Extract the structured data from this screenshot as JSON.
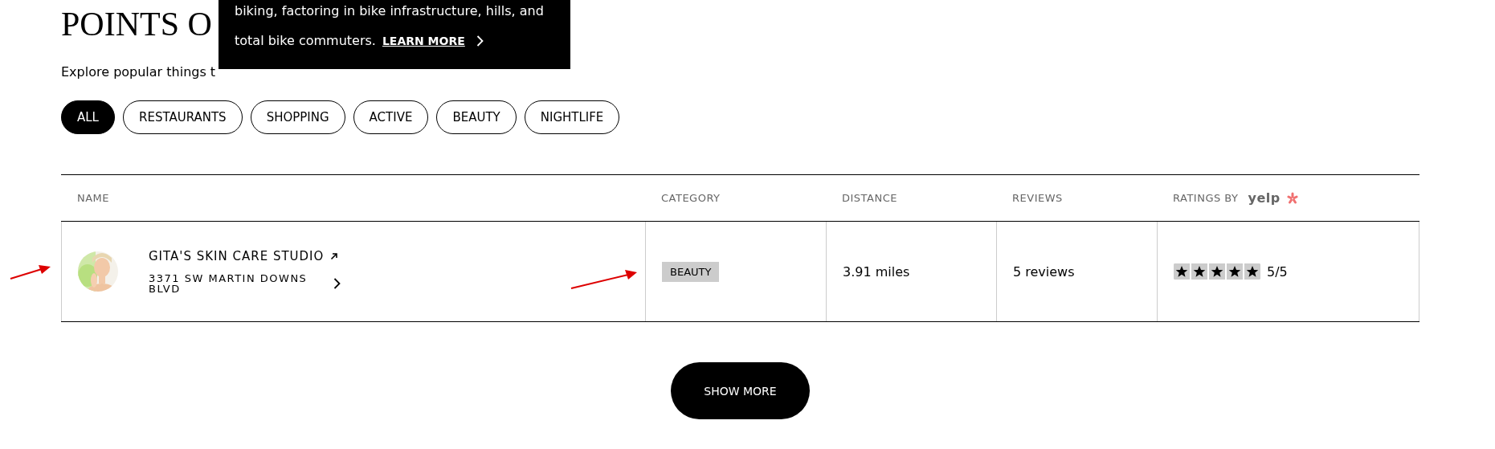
{
  "heading": "POINTS O",
  "subtitle": "Explore popular things t",
  "tooltip": {
    "lines": [
      "biking, factoring in bike infrastructure, hills, and",
      "total bike commuters."
    ],
    "link": "LEARN MORE"
  },
  "tabs": [
    {
      "label": "ALL",
      "selected": true
    },
    {
      "label": "RESTAURANTS",
      "selected": false
    },
    {
      "label": "SHOPPING",
      "selected": false
    },
    {
      "label": "ACTIVE",
      "selected": false
    },
    {
      "label": "BEAUTY",
      "selected": false
    },
    {
      "label": "NIGHTLIFE",
      "selected": false
    }
  ],
  "table": {
    "columns": [
      "NAME",
      "CATEGORY",
      "DISTANCE",
      "REVIEWS",
      "RATINGS BY"
    ],
    "ratings_logo": "yelp",
    "rows": [
      {
        "name": "GITA'S SKIN CARE STUDIO",
        "address": "3371 SW MARTIN DOWNS BLVD",
        "category": "BEAUTY",
        "distance": "3.91 miles",
        "reviews": "5 reviews",
        "stars": 5,
        "rating": "5/5"
      }
    ]
  },
  "show_more": "SHOW MORE"
}
